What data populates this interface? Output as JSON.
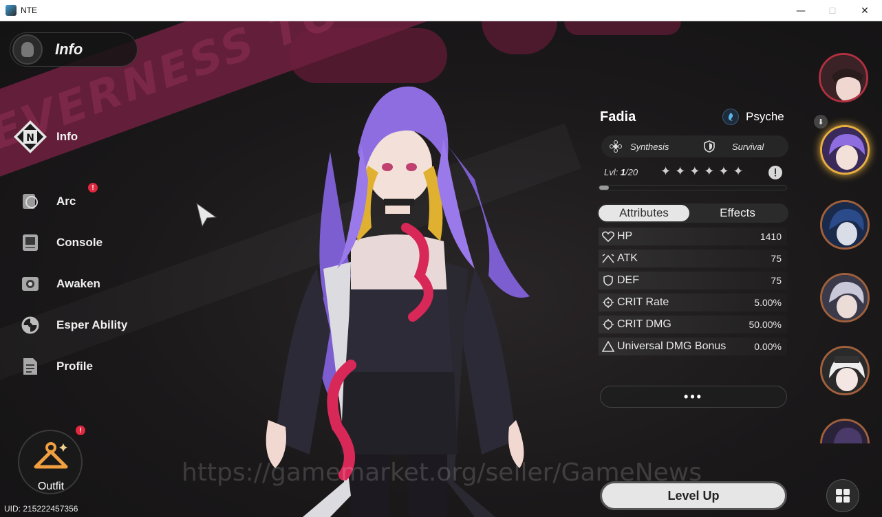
{
  "window": {
    "title": "NTE",
    "minimize": "—",
    "maximize": "☐",
    "close": "✕"
  },
  "background": {
    "banner_text": "EVERNESS TO EVERNESS"
  },
  "header": {
    "title": "Info"
  },
  "nav": {
    "items": [
      {
        "label": "Info",
        "icon": "info-icon",
        "active": true
      },
      {
        "label": "Arc",
        "icon": "arc-icon",
        "badge": "!"
      },
      {
        "label": "Console",
        "icon": "console-icon"
      },
      {
        "label": "Awaken",
        "icon": "awaken-icon"
      },
      {
        "label": "Esper Ability",
        "icon": "esper-ability-icon"
      },
      {
        "label": "Profile",
        "icon": "profile-icon"
      }
    ]
  },
  "outfit": {
    "label": "Outfit",
    "badge": "!"
  },
  "uid": "UID: 215222457356",
  "watermark": "https://gamemarket.org/seller/GameNews",
  "character": {
    "name": "Fadia",
    "element": "Psyche",
    "tags": [
      "Synthesis",
      "Survival"
    ],
    "level_label": "Lvl:",
    "level": "1",
    "level_max": "/20",
    "level_progress": 0.05,
    "stars": [
      "✦",
      "✦",
      "✦",
      "✦",
      "✦",
      "✦"
    ],
    "star_count": 6
  },
  "tabs": {
    "attributes": "Attributes",
    "effects": "Effects"
  },
  "stats": [
    {
      "label": "HP",
      "value": "1410",
      "icon": "heart-icon"
    },
    {
      "label": "ATK",
      "value": "75",
      "icon": "atk-icon"
    },
    {
      "label": "DEF",
      "value": "75",
      "icon": "shield-icon"
    },
    {
      "label": "CRIT Rate",
      "value": "5.00%",
      "icon": "crosshair-icon"
    },
    {
      "label": "CRIT DMG",
      "value": "50.00%",
      "icon": "crosshair-icon"
    },
    {
      "label": "Universal DMG Bonus",
      "value": "0.00%",
      "icon": "triangle-icon"
    }
  ],
  "more_label": "•••",
  "level_up_label": "Level Up",
  "colors": {
    "accent": "#e8b040",
    "badge": "#e02840",
    "banner": "#6c1f3d",
    "hair": "#8b6ad8"
  }
}
